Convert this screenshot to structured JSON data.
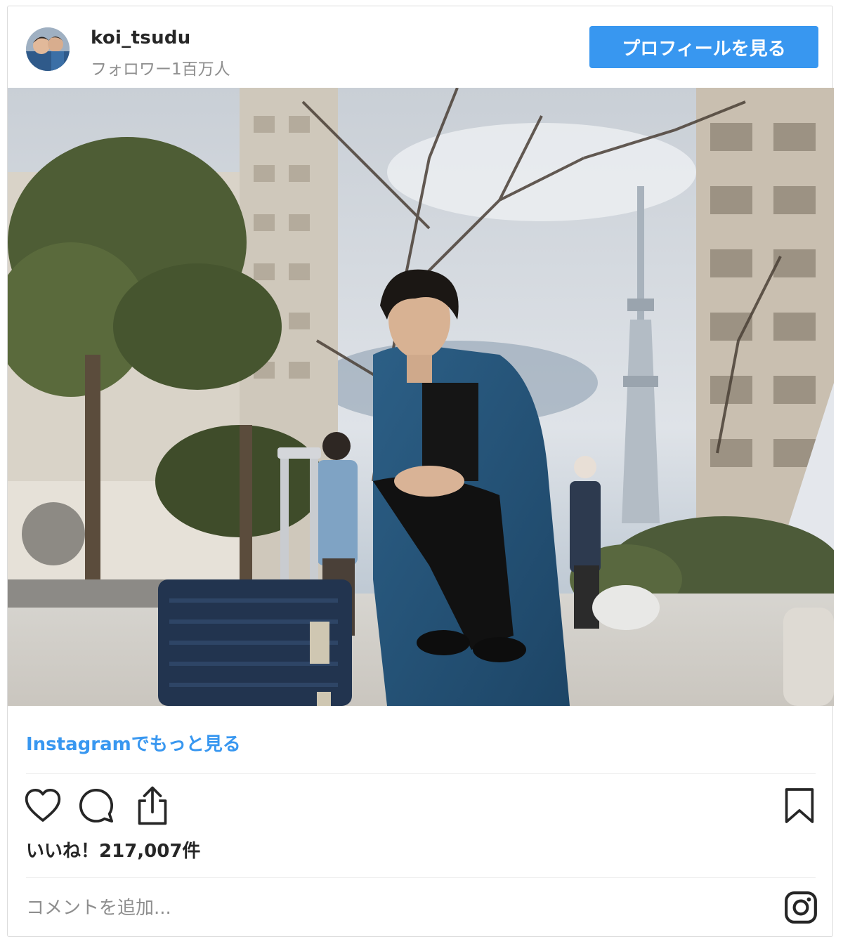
{
  "header": {
    "username": "koi_tsudu",
    "followers": "フォロワー1百万人",
    "profile_button": "プロフィールを見る"
  },
  "photo": {
    "alt": "投稿写真"
  },
  "links": {
    "more_on_instagram": "Instagramでもっと見る"
  },
  "actions": {
    "icons": [
      "heart-icon",
      "comment-icon",
      "share-icon",
      "bookmark-icon"
    ]
  },
  "stats": {
    "likes": "いいね！217,007件"
  },
  "comment": {
    "placeholder": "コメントを追加..."
  },
  "colors": {
    "accent": "#3897f0",
    "text": "#262626",
    "muted": "#8e8e8e",
    "border": "#dbdbdb"
  }
}
